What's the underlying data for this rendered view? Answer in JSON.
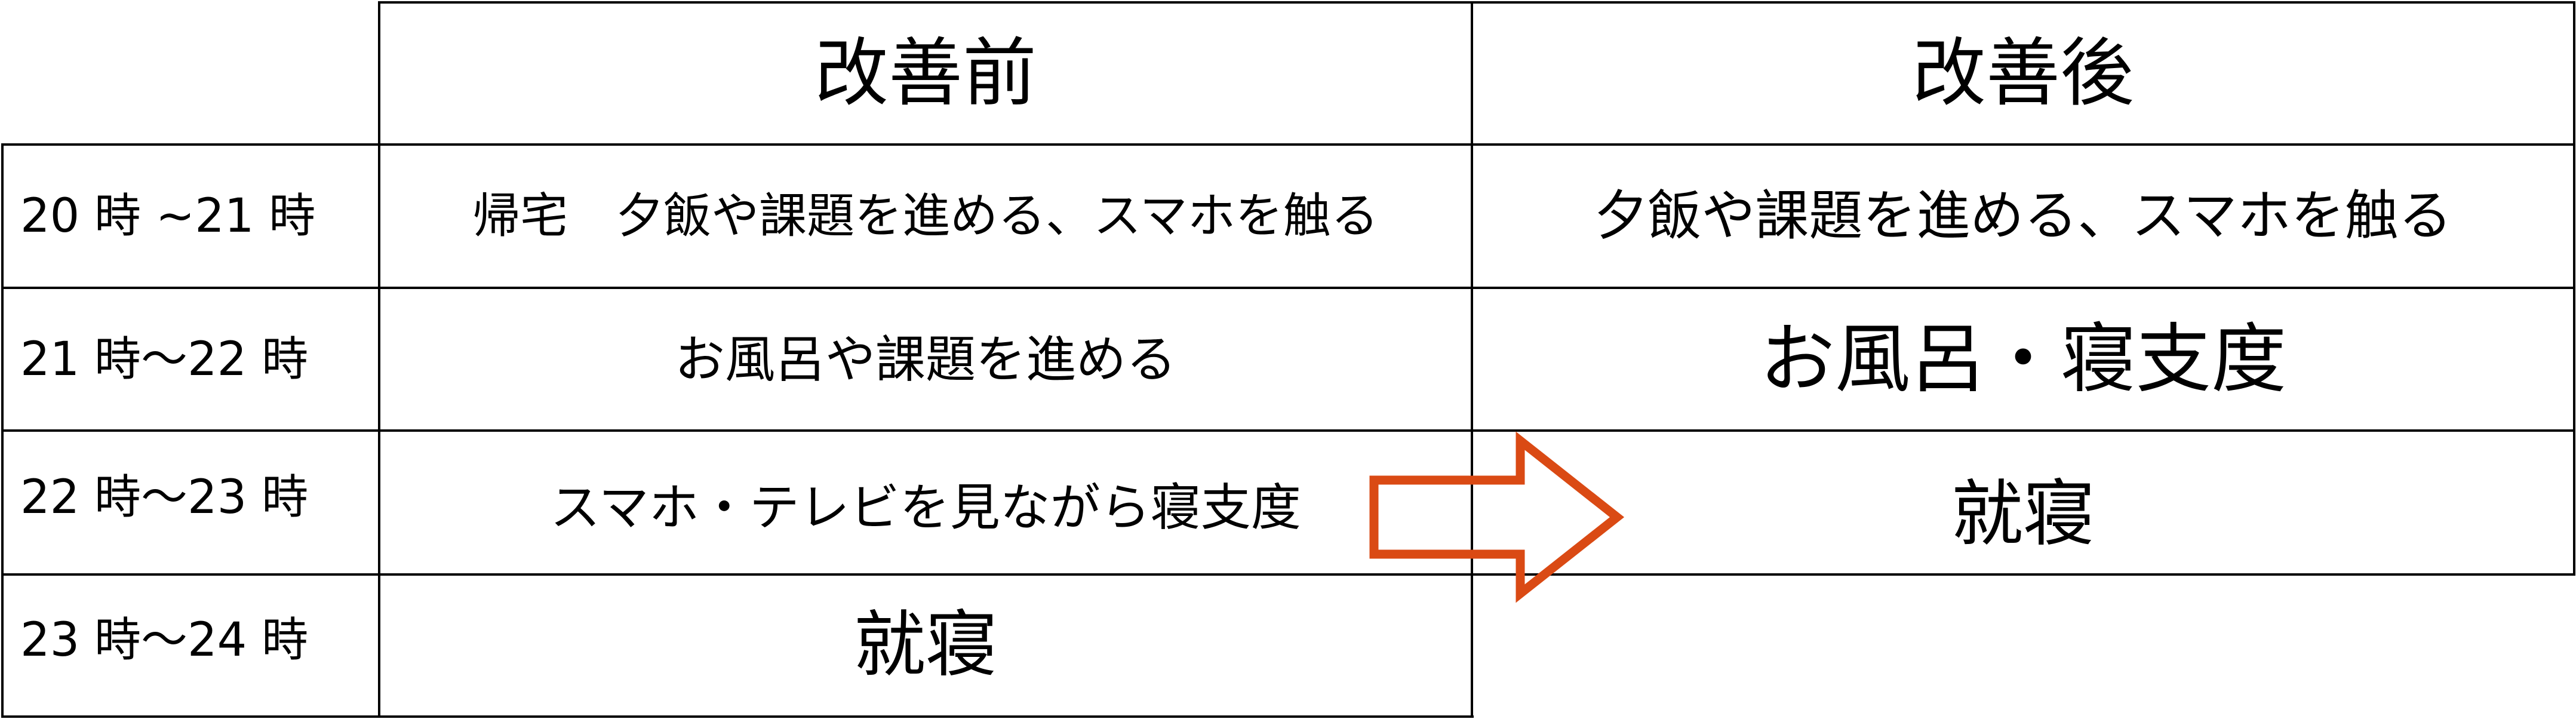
{
  "table": {
    "headers": {
      "corner": "",
      "before": "改善前",
      "after": "改善後"
    },
    "rows": [
      {
        "time": "20 時 ~21 時",
        "before": "帰宅　夕飯や課題を進める、スマホを触る",
        "after": "夕飯や課題を進める、スマホを触る"
      },
      {
        "time": "21 時～22 時",
        "before": "お風呂や課題を進める",
        "after": "お風呂・寝支度"
      },
      {
        "time": "22 時～23 時",
        "before": "スマホ・テレビを見ながら寝支度",
        "after": "就寝"
      },
      {
        "time": "23 時～24 時",
        "before": "就寝",
        "after": ""
      }
    ]
  },
  "arrow": {
    "icon": "right-arrow-icon",
    "direction": "right",
    "color": "#DA4A14"
  },
  "colors": {
    "grid": "#000000",
    "text": "#000000",
    "background": "#ffffff"
  }
}
